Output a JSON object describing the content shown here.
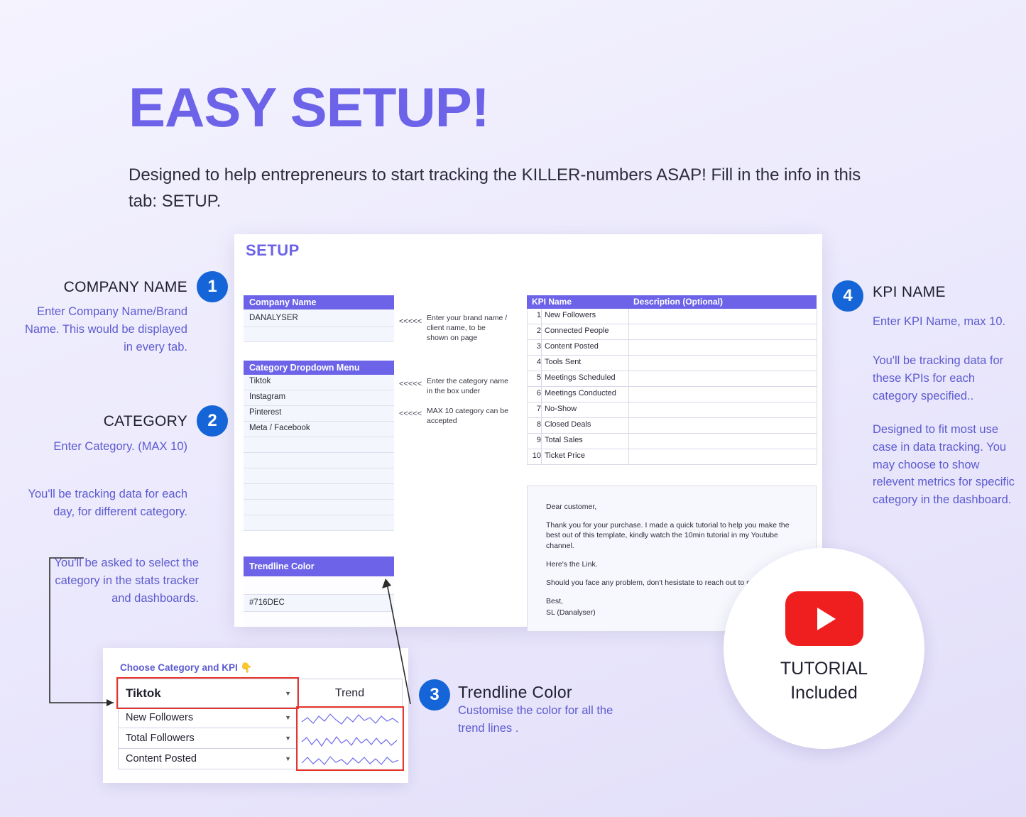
{
  "headline": "EASY SETUP!",
  "subhead": "Designed to help entrepreneurs to start tracking the KILLER-numbers ASAP! Fill in the info in this tab: SETUP.",
  "annotations": [
    {
      "number": "1",
      "title": "COMPANY NAME",
      "body": "Enter Company Name/Brand Name. This would be displayed in every tab."
    },
    {
      "number": "2",
      "title": "CATEGORY",
      "body": "Enter Category.  (MAX 10)",
      "body2": "You'll be tracking data for each day, for different category.",
      "body3": "You'll be asked to select the category in the stats tracker and dashboards."
    },
    {
      "number": "3",
      "title": "Trendline Color",
      "body": "Customise the color for all the trend lines ."
    },
    {
      "number": "4",
      "title": "KPI NAME",
      "body": "Enter KPI Name, max 10.",
      "body2": "You'll be tracking data for these KPIs for each category specified..",
      "body3": "Designed to fit most use case in data tracking. You may choose to show relevent metrics for specific category in the dashboard."
    }
  ],
  "sheet": {
    "title": "SETUP",
    "company_block": {
      "header": "Company Name",
      "value": "DANALYSER"
    },
    "category_block": {
      "header": "Category Dropdown Menu",
      "values": [
        "Tiktok",
        "Instagram",
        "Pinterest",
        "Meta / Facebook",
        "",
        "",
        "",
        "",
        "",
        ""
      ]
    },
    "trendline_block": {
      "header": "Trendline Color",
      "value": "#716DEC"
    },
    "arrows": "<<<<<",
    "notes": [
      "Enter your brand name / client name, to be shown on page",
      "Enter the category name in the box under",
      "MAX 10 category can be accepted"
    ],
    "kpi_table": {
      "headers": [
        "KPI Name",
        "Description (Optional)"
      ],
      "rows": [
        {
          "num": "1",
          "name": "New Followers",
          "desc": ""
        },
        {
          "num": "2",
          "name": "Connected People",
          "desc": ""
        },
        {
          "num": "3",
          "name": "Content Posted",
          "desc": ""
        },
        {
          "num": "4",
          "name": "Tools Sent",
          "desc": ""
        },
        {
          "num": "5",
          "name": "Meetings Scheduled",
          "desc": ""
        },
        {
          "num": "6",
          "name": "Meetings Conducted",
          "desc": ""
        },
        {
          "num": "7",
          "name": "No-Show",
          "desc": ""
        },
        {
          "num": "8",
          "name": "Closed Deals",
          "desc": ""
        },
        {
          "num": "9",
          "name": "Total Sales",
          "desc": ""
        },
        {
          "num": "10",
          "name": "Ticket Price",
          "desc": ""
        }
      ]
    },
    "letter": {
      "greeting": "Dear customer,",
      "p1": "Thank you for your purchase. I made a quick tutorial to help you make the best out of this template, kindly watch the 10min tutorial in my Youtube channel.",
      "p2": "Here's the Link.",
      "p3": "Should you face any problem, don't hesistate to reach out to me.",
      "sign1": "Best,",
      "sign2": "SL (Danalyser)"
    }
  },
  "mini_panel": {
    "title": "Choose Category and KPI",
    "pointer_icon": "pointing-down-hand",
    "selected_category": "Tiktok",
    "trend_header": "Trend",
    "kpi_rows": [
      "New Followers",
      "Total Followers",
      "Content Posted"
    ]
  },
  "tutorial": {
    "icon": "youtube-play-icon",
    "line1": "TUTORIAL",
    "line2": "Included"
  },
  "colors": {
    "accent": "#6c63e8",
    "badge": "#1565d8",
    "trendline": "#716DEC",
    "highlight_red": "#e8352b"
  }
}
